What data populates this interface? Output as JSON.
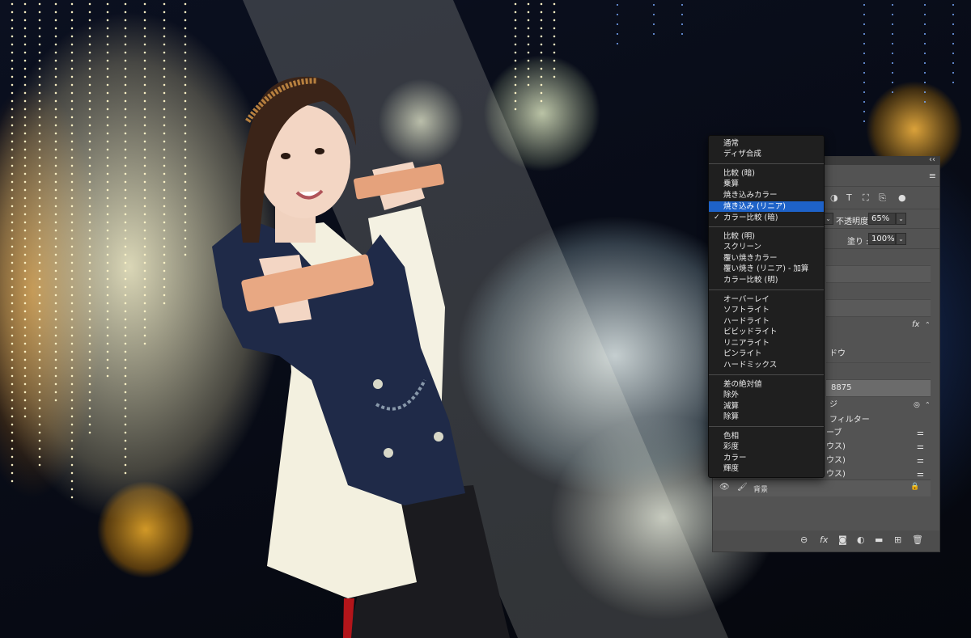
{
  "canvas": {
    "description_icon": "photo-canvas"
  },
  "blend_menu": {
    "groups": [
      [
        "通常",
        "ディザ合成"
      ],
      [
        "比較 (暗)",
        "乗算",
        "焼き込みカラー",
        "焼き込み (リニア)",
        "カラー比較 (暗)"
      ],
      [
        "比較 (明)",
        "スクリーン",
        "覆い焼きカラー",
        "覆い焼き (リニア) - 加算",
        "カラー比較 (明)"
      ],
      [
        "オーバーレイ",
        "ソフトライト",
        "ハードライト",
        "ビビッドライト",
        "リニアライト",
        "ピンライト",
        "ハードミックス"
      ],
      [
        "差の絶対値",
        "除外",
        "減算",
        "除算"
      ],
      [
        "色相",
        "彩度",
        "カラー",
        "輝度"
      ]
    ],
    "highlighted": "焼き込み (リニア)",
    "checked": "カラー比較 (暗)",
    "check_mark": "✓"
  },
  "layers_panel": {
    "collapse_label": "‹‹",
    "menu_icon": "≡",
    "opacity_label": "不透明度 :",
    "opacity_value": "65%",
    "fill_label": "塗り :",
    "fill_value": "100%",
    "dropdown_arrow": "⌄",
    "fx_label": "fx",
    "layers": [
      {
        "label": "ドウ"
      },
      {
        "label": "8875"
      },
      {
        "label": "ジ"
      },
      {
        "label": "フィルター"
      },
      {
        "label": "ーブ"
      },
      {
        "label": "ウス)"
      },
      {
        "label": "ウス)"
      },
      {
        "label": "ウス)"
      }
    ],
    "background_layer_label": "背景",
    "eye_icon_glyph": "👁",
    "brush_glyph": "🖌",
    "lock_glyph": "🔒"
  },
  "colors": {
    "menu_highlight": "#1e62c8",
    "panel_bg": "#535353",
    "menu_bg": "#1f1f1f"
  }
}
